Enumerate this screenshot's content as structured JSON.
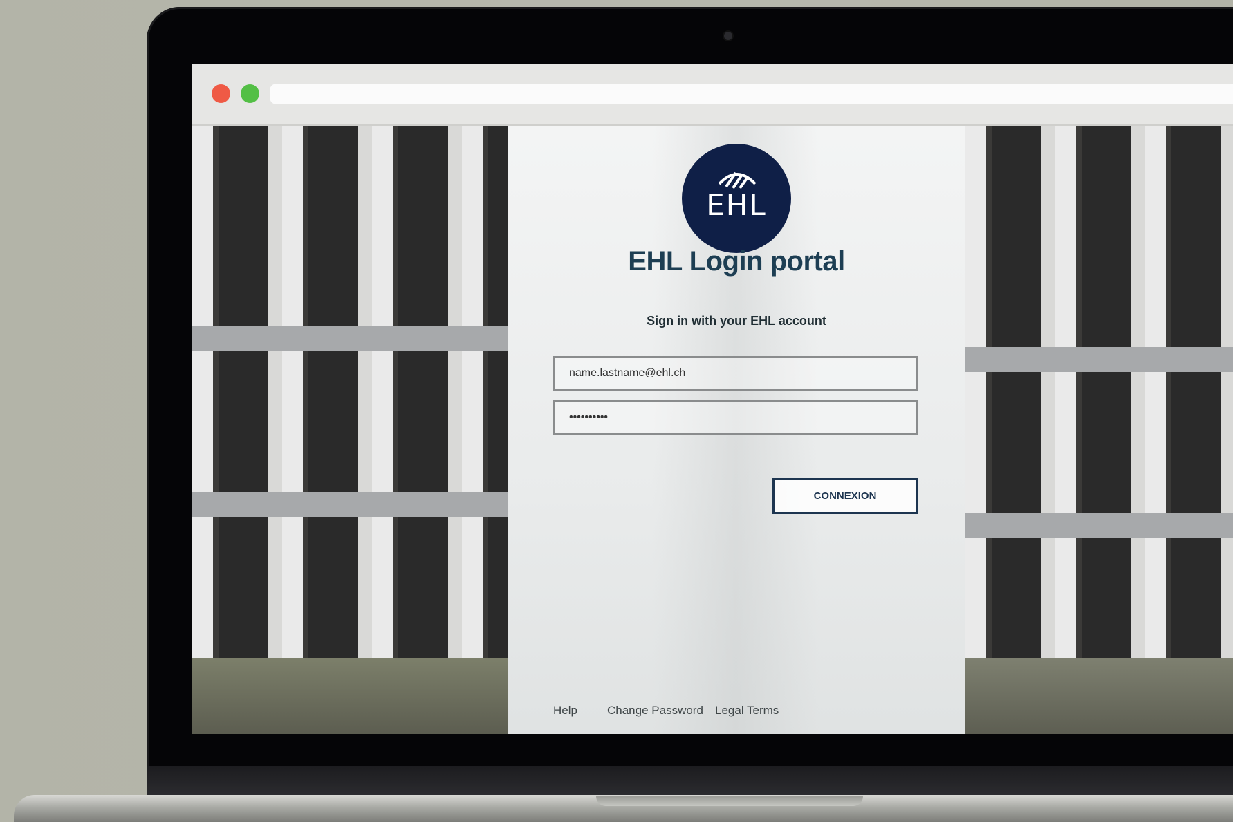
{
  "browser": {
    "buttons": [
      "close",
      "zoom"
    ],
    "address": ""
  },
  "login": {
    "logo_text": "EHL",
    "title": "EHL Login portal",
    "subtitle": "Sign in with your EHL account",
    "email_value": "name.lastname@ehl.ch",
    "password_value": "••••••••••",
    "submit_label": "CONNEXION"
  },
  "footer": {
    "help": "Help",
    "change_password": "Change Password",
    "legal_terms": "Legal Terms"
  },
  "colors": {
    "brand_navy": "#0f1f47",
    "title": "#1d3e53",
    "close_dot": "#ef5a45",
    "zoom_dot": "#53bf45"
  }
}
